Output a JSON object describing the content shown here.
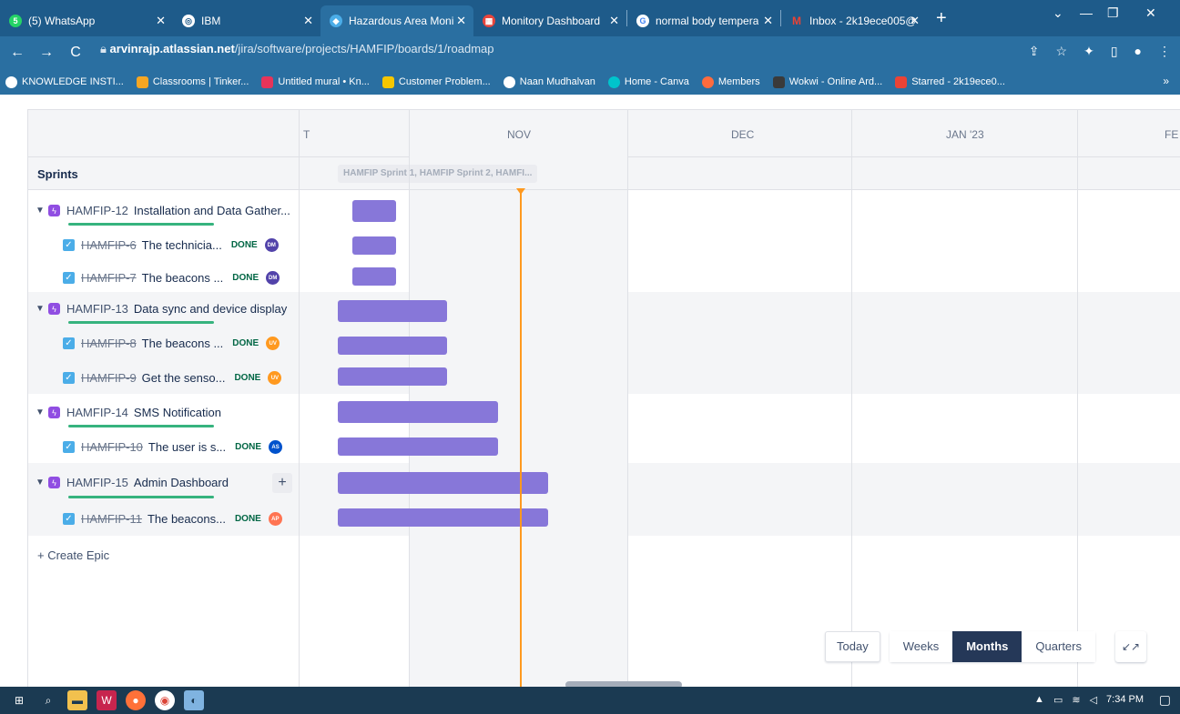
{
  "browser": {
    "tabs": [
      {
        "label": "(5) WhatsApp",
        "icon": "whatsapp-icon",
        "color": "#25d366"
      },
      {
        "label": "IBM",
        "icon": "globe-icon",
        "color": "#ffffff"
      },
      {
        "label": "Hazardous Area Moni",
        "icon": "jira-icon",
        "color": "#4bade8"
      },
      {
        "label": "Monitory Dashboard",
        "icon": "dashboard-icon",
        "color": "#e8453c"
      },
      {
        "label": "normal body tempera",
        "icon": "google-icon",
        "color": "#ffffff"
      },
      {
        "label": "Inbox - 2k19ece005@",
        "icon": "gmail-icon",
        "color": "#ea4335"
      }
    ],
    "url_domain": "arvinrajp.atlassian.net",
    "url_path": "/jira/software/projects/HAMFIP/boards/1/roadmap",
    "bookmarks": [
      {
        "label": "KNOWLEDGE INSTI...",
        "color": "#ffffff"
      },
      {
        "label": "Classrooms | Tinker...",
        "color": "#f5a623"
      },
      {
        "label": "Untitled mural • Kn...",
        "color": "#e6345a"
      },
      {
        "label": "Customer Problem...",
        "color": "#f6c700"
      },
      {
        "label": "Naan Mudhalvan",
        "color": "#ffffff"
      },
      {
        "label": "Home - Canva",
        "color": "#00c4cc"
      },
      {
        "label": "Members",
        "color": "#ff6b3d"
      },
      {
        "label": "Wokwi - Online Ard...",
        "color": "#3a3a3a"
      },
      {
        "label": "Starred - 2k19ece0...",
        "color": "#ea4335"
      }
    ],
    "bookmarks_more": "»"
  },
  "roadmap": {
    "months": [
      "T",
      "NOV",
      "DEC",
      "JAN '23",
      "FE"
    ],
    "sprints_label": "Sprints",
    "sprint_chip": "HAMFIP Sprint 1, HAMFIP Sprint 2, HAMFI...",
    "create_epic": "+ Create Epic",
    "rows": [
      {
        "type": "epic",
        "key": "HAMFIP-12",
        "title": "Installation and Data Gather..."
      },
      {
        "type": "task",
        "key": "HAMFIP-6",
        "title": "The technicia...",
        "status": "DONE",
        "avatar": "DM",
        "avatar_color": "#5243aa"
      },
      {
        "type": "task",
        "key": "HAMFIP-7",
        "title": "The beacons ...",
        "status": "DONE",
        "avatar": "DM",
        "avatar_color": "#5243aa"
      },
      {
        "type": "epic",
        "key": "HAMFIP-13",
        "title": "Data sync and device display"
      },
      {
        "type": "task",
        "key": "HAMFIP-8",
        "title": "The beacons ...",
        "status": "DONE",
        "avatar": "UV",
        "avatar_color": "#ff991f"
      },
      {
        "type": "task",
        "key": "HAMFIP-9",
        "title": "Get the senso...",
        "status": "DONE",
        "avatar": "UV",
        "avatar_color": "#ff991f"
      },
      {
        "type": "epic",
        "key": "HAMFIP-14",
        "title": "SMS Notification"
      },
      {
        "type": "task",
        "key": "HAMFIP-10",
        "title": "The user is s...",
        "status": "DONE",
        "avatar": "AS",
        "avatar_color": "#0052cc"
      },
      {
        "type": "epic",
        "key": "HAMFIP-15",
        "title": "Admin Dashboard"
      },
      {
        "type": "task",
        "key": "HAMFIP-11",
        "title": "The beacons...",
        "status": "DONE",
        "avatar": "AP",
        "avatar_color": "#ff7452"
      }
    ],
    "add_button": "+",
    "controls": {
      "today": "Today",
      "weeks": "Weeks",
      "months": "Months",
      "quarters": "Quarters",
      "active": "Months"
    }
  },
  "taskbar": {
    "time": "7:34 PM"
  }
}
